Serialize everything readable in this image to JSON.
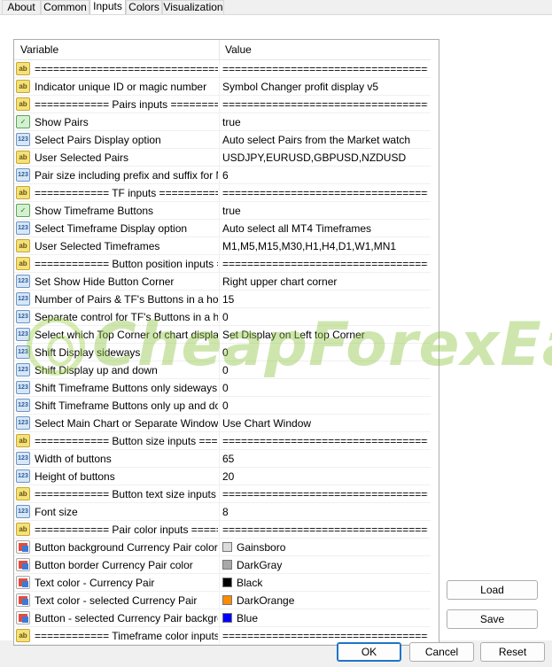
{
  "tabs": [
    {
      "label": "About"
    },
    {
      "label": "Common"
    },
    {
      "label": "Inputs"
    },
    {
      "label": "Colors"
    },
    {
      "label": "Visualization"
    }
  ],
  "active_tab": "Inputs",
  "grid": {
    "header": {
      "variable": "Variable",
      "value": "Value"
    },
    "rows": [
      {
        "icon": "ab",
        "name": "==================================",
        "value": "========================================="
      },
      {
        "icon": "ab",
        "name": "Indicator unique ID or magic number",
        "value": "Symbol Changer profit display v5"
      },
      {
        "icon": "ab",
        "name": "============ Pairs inputs ===========",
        "value": "========================================="
      },
      {
        "icon": "bool",
        "name": "Show Pairs",
        "value": "true"
      },
      {
        "icon": "num",
        "name": "Select Pairs Display option",
        "value": "Auto select Pairs from the Market watch"
      },
      {
        "icon": "ab",
        "name": "User Selected Pairs",
        "value": "USDJPY,EURUSD,GBPUSD,NZDUSD"
      },
      {
        "icon": "num",
        "name": "Pair size including prefix and suffix for Ma...",
        "value": "6"
      },
      {
        "icon": "ab",
        "name": "============ TF inputs ===========",
        "value": "========================================="
      },
      {
        "icon": "bool",
        "name": "Show Timeframe Buttons",
        "value": "true"
      },
      {
        "icon": "num",
        "name": "Select Timeframe Display option",
        "value": "Auto select all MT4 Timeframes"
      },
      {
        "icon": "ab",
        "name": "User Selected Timeframes",
        "value": "M1,M5,M15,M30,H1,H4,D1,W1,MN1"
      },
      {
        "icon": "ab",
        "name": "============ Button position inputs ====",
        "value": "========================================="
      },
      {
        "icon": "num",
        "name": "Set Show Hide Button Corner",
        "value": "Right upper chart corner"
      },
      {
        "icon": "num",
        "name": "Number of Pairs & TF's Buttons in a horiz...",
        "value": "15"
      },
      {
        "icon": "num",
        "name": "Separate control for TF's Buttons in a hori...",
        "value": "0"
      },
      {
        "icon": "num",
        "name": "Select which Top Corner of chart display l...",
        "value": "Set Display on Left top Corner"
      },
      {
        "icon": "num",
        "name": "Shift Display sideways",
        "value": "0"
      },
      {
        "icon": "num",
        "name": "Shift Display up and down",
        "value": "0"
      },
      {
        "icon": "num",
        "name": "Shift Timeframe Buttons only sideways",
        "value": "0"
      },
      {
        "icon": "num",
        "name": "Shift Timeframe Buttons only up and down",
        "value": "0"
      },
      {
        "icon": "num",
        "name": "Select Main Chart or Separate Window",
        "value": "Use Chart Window"
      },
      {
        "icon": "ab",
        "name": "============ Button size inputs ====....",
        "value": "========================================="
      },
      {
        "icon": "num",
        "name": "Width of buttons",
        "value": "65"
      },
      {
        "icon": "num",
        "name": "Height of buttons",
        "value": "20"
      },
      {
        "icon": "ab",
        "name": "============ Button text size inputs =...",
        "value": "========================================="
      },
      {
        "icon": "num",
        "name": "Font size",
        "value": "8"
      },
      {
        "icon": "ab",
        "name": "============ Pair color inputs =======",
        "value": "========================================="
      },
      {
        "icon": "color",
        "name": "Button background Currency Pair color",
        "value": "Gainsboro",
        "swatch": "#dcdcdc"
      },
      {
        "icon": "color",
        "name": "Button border Currency Pair color",
        "value": "DarkGray",
        "swatch": "#a9a9a9"
      },
      {
        "icon": "color",
        "name": "Text color -  Currency Pair",
        "value": "Black",
        "swatch": "#000000"
      },
      {
        "icon": "color",
        "name": "Text color - selected Currency Pair",
        "value": "DarkOrange",
        "swatch": "#ff8c00"
      },
      {
        "icon": "color",
        "name": "Button - selected Currency Pair backgrou...",
        "value": "Blue",
        "swatch": "#0000ff"
      },
      {
        "icon": "ab",
        "name": "============ Timeframe color inputs ...",
        "value": "========================================="
      }
    ]
  },
  "watermark": {
    "text": "CheapForexEa"
  },
  "side_buttons": {
    "load": "Load",
    "save": "Save"
  },
  "footer": {
    "ok": "OK",
    "cancel": "Cancel",
    "reset": "Reset"
  },
  "icon_glyphs": {
    "ab": "ab",
    "num": "123",
    "bool": "✓",
    "color": ""
  }
}
